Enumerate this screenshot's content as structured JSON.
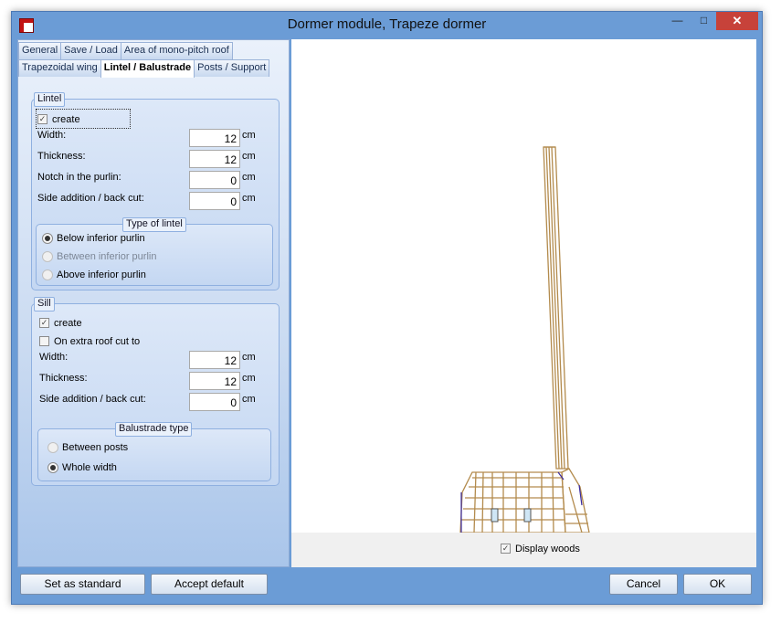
{
  "window": {
    "title": "Dormer module, Trapeze dormer",
    "minimize_glyph": "—",
    "maximize_glyph": "□",
    "close_glyph": "✕"
  },
  "tabs": {
    "row1": [
      "General",
      "Save / Load",
      "Area of mono-pitch roof"
    ],
    "row2": [
      "Trapezoidal wing",
      "Lintel / Balustrade",
      "Posts / Support"
    ],
    "active": "Lintel / Balustrade"
  },
  "lintel": {
    "title": "Lintel",
    "create_label": "create",
    "create_checked": true,
    "width_label": "Width:",
    "width_value": "12",
    "thickness_label": "Thickness:",
    "thickness_value": "12",
    "notch_label": "Notch in the purlin:",
    "notch_value": "0",
    "side_label": "Side addition / back cut:",
    "side_value": "0",
    "unit": "cm",
    "type_title": "Type of lintel",
    "type_options": [
      "Below inferior purlin",
      "Between inferior purlin",
      "Above inferior purlin"
    ],
    "type_selected": "Below inferior purlin"
  },
  "sill": {
    "title": "Sill",
    "create_label": "create",
    "create_checked": true,
    "extra_label": "On extra roof cut to",
    "extra_checked": false,
    "width_label": "Width:",
    "width_value": "12",
    "thickness_label": "Thickness:",
    "thickness_value": "12",
    "side_label": "Side addition / back cut:",
    "side_value": "0",
    "unit": "cm",
    "balustrade_title": "Balustrade type",
    "balustrade_options": [
      "Between posts",
      "Whole width"
    ],
    "balustrade_selected": "Whole width"
  },
  "preview": {
    "display_woods_label": "Display woods",
    "display_woods_checked": true,
    "wood_color": "#b38b4d",
    "accent_color": "#3a2aa0"
  },
  "buttons": {
    "set_standard": "Set as standard",
    "accept_default": "Accept default",
    "cancel": "Cancel",
    "ok": "OK"
  }
}
